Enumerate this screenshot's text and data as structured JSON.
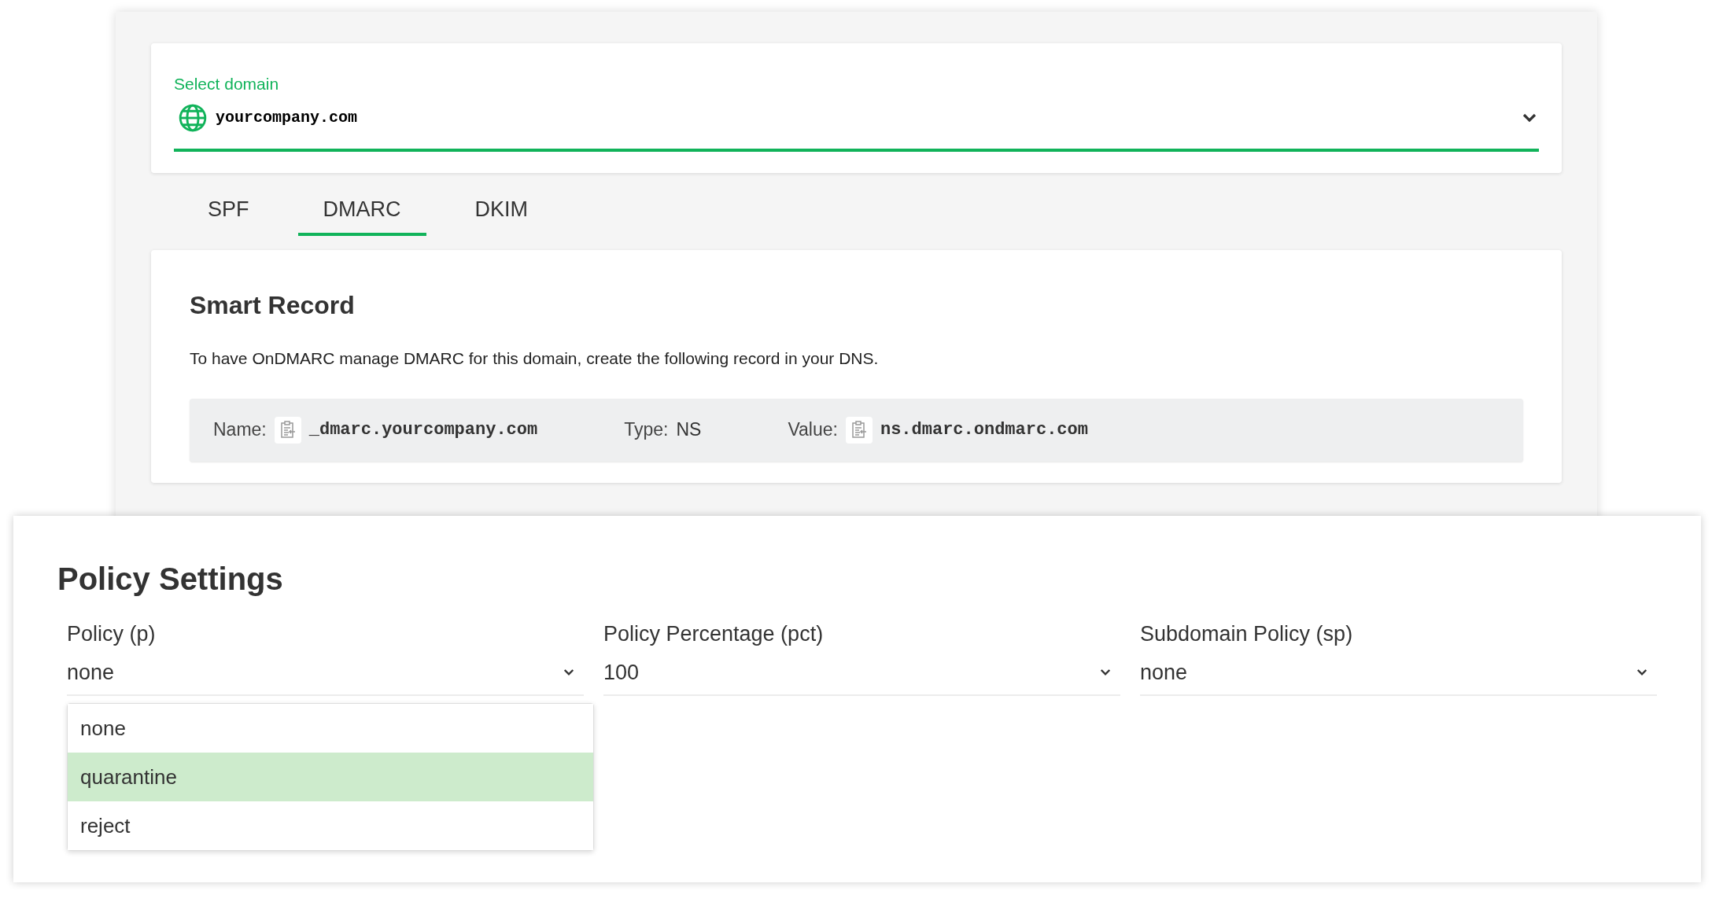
{
  "domain_select": {
    "label": "Select domain",
    "value": "yourcompany.com"
  },
  "tabs": [
    {
      "label": "SPF",
      "selected": false
    },
    {
      "label": "DMARC",
      "selected": true
    },
    {
      "label": "DKIM",
      "selected": false
    }
  ],
  "smart_record": {
    "title": "Smart Record",
    "description": "To have OnDMARC manage DMARC for this domain, create the following record in your DNS.",
    "fields": [
      {
        "label": "Name:",
        "value": "_dmarc.yourcompany.com",
        "kind": "copy"
      },
      {
        "label": "Type:",
        "value": "NS",
        "kind": "plain"
      },
      {
        "label": "Value:",
        "value": "ns.dmarc.ondmarc.com",
        "kind": "copy"
      }
    ]
  },
  "policy_settings": {
    "title": "Policy Settings",
    "fields": [
      {
        "label": "Policy (p)",
        "value": "none",
        "options": [
          {
            "label": "none",
            "highlighted": false
          },
          {
            "label": "quarantine",
            "highlighted": true
          },
          {
            "label": "reject",
            "highlighted": false
          }
        ]
      },
      {
        "label": "Policy Percentage (pct)",
        "value": "100"
      },
      {
        "label": "Subdomain Policy (sp)",
        "value": "none"
      }
    ]
  }
}
